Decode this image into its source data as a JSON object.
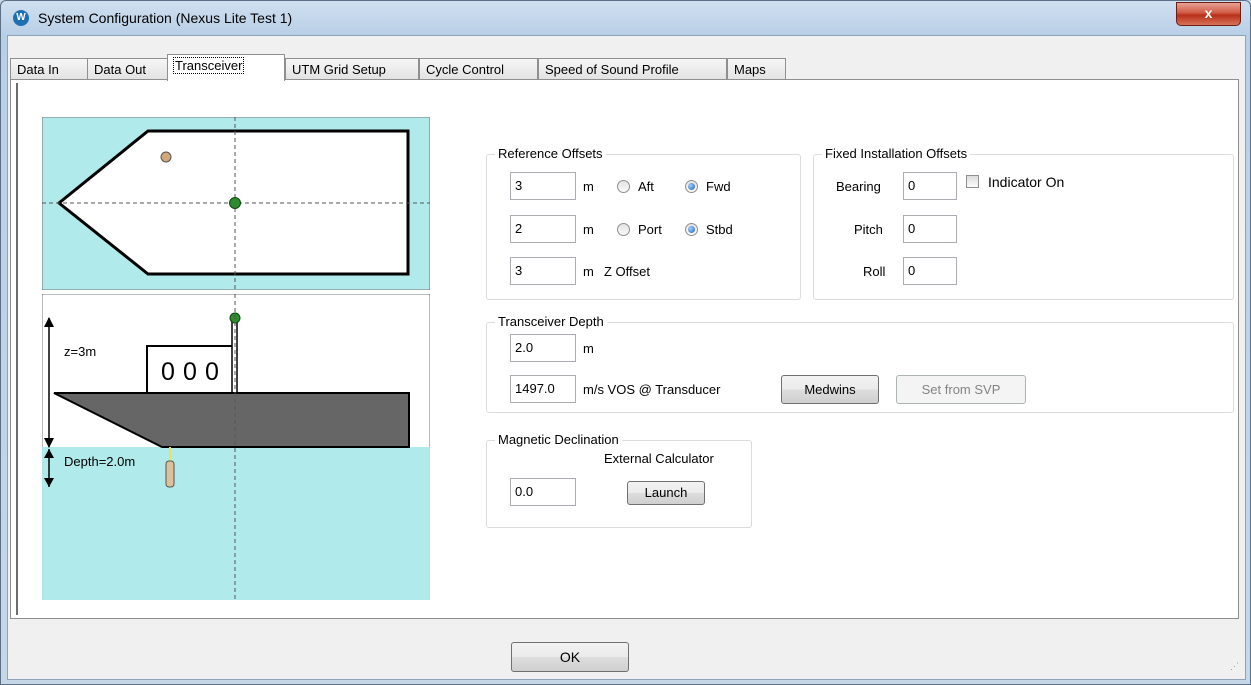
{
  "window": {
    "title": "System Configuration (Nexus Lite Test 1)",
    "app_icon_glyph": "W",
    "close_glyph": "x"
  },
  "tabs": [
    {
      "label": "Data In",
      "active": false
    },
    {
      "label": "Data Out",
      "active": false
    },
    {
      "label": "Transceiver",
      "active": true
    },
    {
      "label": "UTM Grid Setup",
      "active": false
    },
    {
      "label": "Cycle Control",
      "active": false
    },
    {
      "label": "Speed of Sound Profile",
      "active": false
    },
    {
      "label": "Maps",
      "active": false
    }
  ],
  "diagram": {
    "z_label": "z=3m",
    "depth_label": "Depth=2.0m",
    "cabin_windows": [
      "0",
      "0",
      "0"
    ],
    "colors": {
      "water": "#b0eaea",
      "hull": "#666666",
      "transducer": "#e0c09a",
      "reference_point": "#2e8b2e",
      "mast_point": "#d2a77a"
    }
  },
  "reference_offsets": {
    "title": "Reference Offsets",
    "row1": {
      "value": "3",
      "unit": "m",
      "opt_a": "Aft",
      "opt_b": "Fwd",
      "selected": "Fwd"
    },
    "row2": {
      "value": "2",
      "unit": "m",
      "opt_a": "Port",
      "opt_b": "Stbd",
      "selected": "Stbd"
    },
    "row3": {
      "value": "3",
      "unit": "m",
      "label": "Z Offset"
    }
  },
  "fixed_offsets": {
    "title": "Fixed Installation Offsets",
    "bearing_label": "Bearing",
    "bearing_value": "0",
    "indicator_label": "Indicator On",
    "pitch_label": "Pitch",
    "pitch_value": "0",
    "roll_label": "Roll",
    "roll_value": "0"
  },
  "transceiver_depth": {
    "title": "Transceiver Depth",
    "depth_value": "2.0",
    "depth_unit": "m",
    "vos_value": "1497.0",
    "vos_label": "m/s VOS @ Transducer",
    "medwins_label": "Medwins",
    "set_from_svp_label": "Set from SVP"
  },
  "magnetic_declination": {
    "title": "Magnetic Declination",
    "calculator_label": "External Calculator",
    "value": "0.0",
    "launch_label": "Launch"
  },
  "footer": {
    "ok_label": "OK"
  }
}
